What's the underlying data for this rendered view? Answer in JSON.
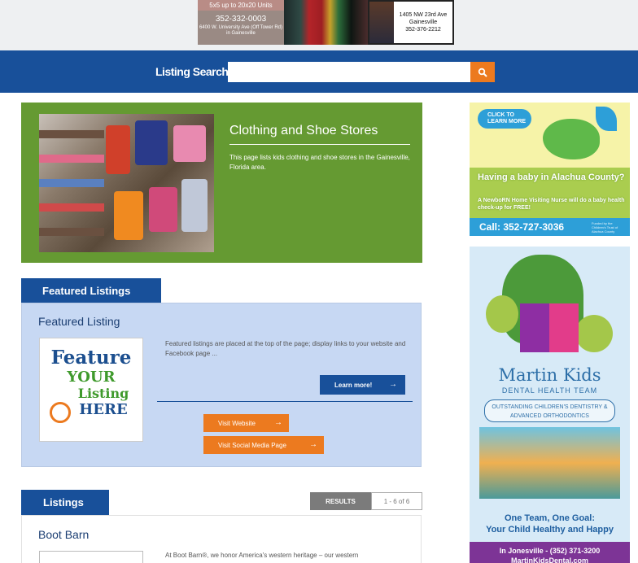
{
  "top_ads": {
    "storage": {
      "line1": "5x5 up to 20x20 Units",
      "phone": "352-332-0003",
      "address": "6400 W. University Ave (Off Tower Rd) in Gainesville"
    },
    "address_ad": {
      "street": "1405 NW 23rd Ave",
      "city": "Gainesville",
      "phone": "352-376-2212"
    }
  },
  "search": {
    "label": "Listing Search:",
    "value": "",
    "placeholder": "",
    "icon": "search-icon"
  },
  "hero": {
    "title": "Clothing and Shoe Stores",
    "description": "This page lists kids clothing and shoe stores in the Gainesville, Florida area."
  },
  "featured": {
    "tab_label": "Featured Listings",
    "listing_title": "Featured Listing",
    "logo": {
      "line1": "Feature",
      "line2": "YOUR",
      "line3": "Listing",
      "line4": "HERE"
    },
    "description": "Featured listings are placed at the top of the page; display links to your website and Facebook page ...",
    "learn_more": "Learn more!",
    "visit_website": "Visit Website",
    "visit_social": "Visit Social Media Page"
  },
  "listings": {
    "tab_label": "Listings",
    "results_label": "RESULTS",
    "results_value": "1 - 6 of 6",
    "items": [
      {
        "name": "Boot Barn",
        "description": "At Boot Barn®, we honor America's western heritage – our western"
      }
    ]
  },
  "sidebar_ads": {
    "baby": {
      "click": "CLICK TO LEARN MORE",
      "headline": "Having a baby in Alachua County?",
      "subtext": "A NewboRN Home Visiting Nurse will do a baby health check-up for FREE!",
      "call": "Call: 352-727-3036",
      "fine": "Funded by the Children's Trust of Alachua County"
    },
    "dental": {
      "name": "Martin Kids",
      "team": "DENTAL HEALTH TEAM",
      "tagline": "OUTSTANDING CHILDREN'S DENTISTRY & ADVANCED ORTHODONTICS",
      "slogan_line1": "One Team, One Goal:",
      "slogan_line2": "Your Child Healthy and Happy",
      "phone": "In Jonesville - (352) 371-3200",
      "website": "MartinKidsDental.com"
    }
  },
  "colors": {
    "brand_blue": "#18509a",
    "accent_orange": "#ec7a1f",
    "hero_green": "#659a32",
    "featured_bg": "#c7d8f3"
  }
}
